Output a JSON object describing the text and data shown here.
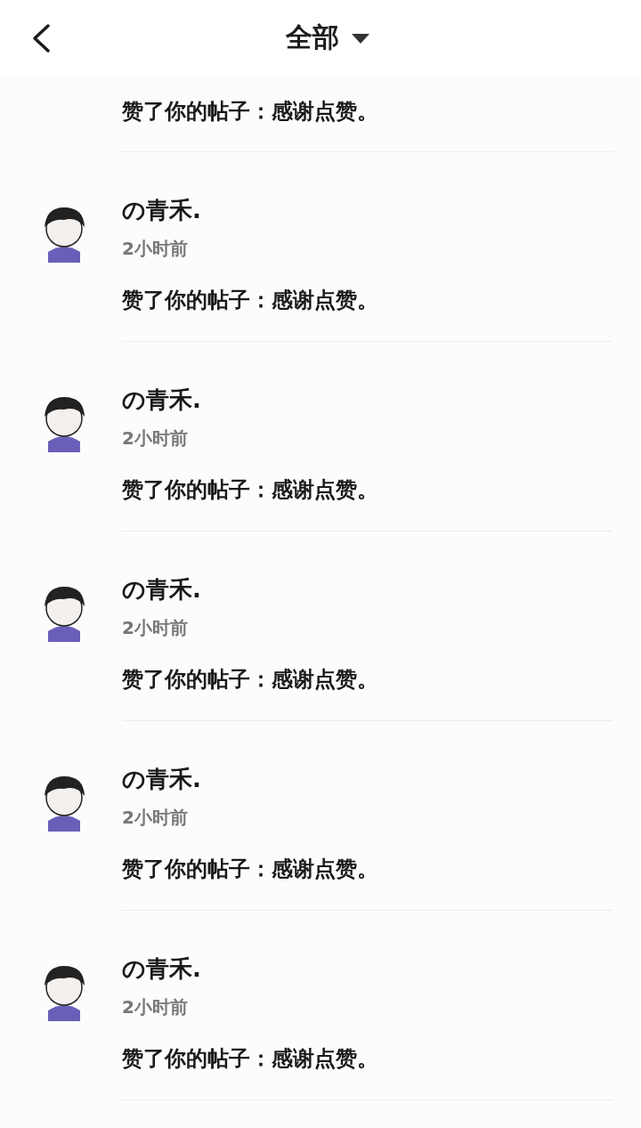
{
  "header": {
    "title": "全部"
  },
  "notifications": [
    {
      "kind": "cut",
      "content": "赞了你的帖子：感谢点赞。"
    },
    {
      "kind": "full",
      "name": "の青禾.",
      "time": "2小时前",
      "content": "赞了你的帖子：感谢点赞。"
    },
    {
      "kind": "full",
      "name": "の青禾.",
      "time": "2小时前",
      "content": "赞了你的帖子：感谢点赞。"
    },
    {
      "kind": "full",
      "name": "の青禾.",
      "time": "2小时前",
      "content": "赞了你的帖子：感谢点赞。"
    },
    {
      "kind": "full",
      "name": "の青禾.",
      "time": "2小时前",
      "content": "赞了你的帖子：感谢点赞。"
    },
    {
      "kind": "full",
      "name": "の青禾.",
      "time": "2小时前",
      "content": "赞了你的帖子：感谢点赞。"
    }
  ]
}
